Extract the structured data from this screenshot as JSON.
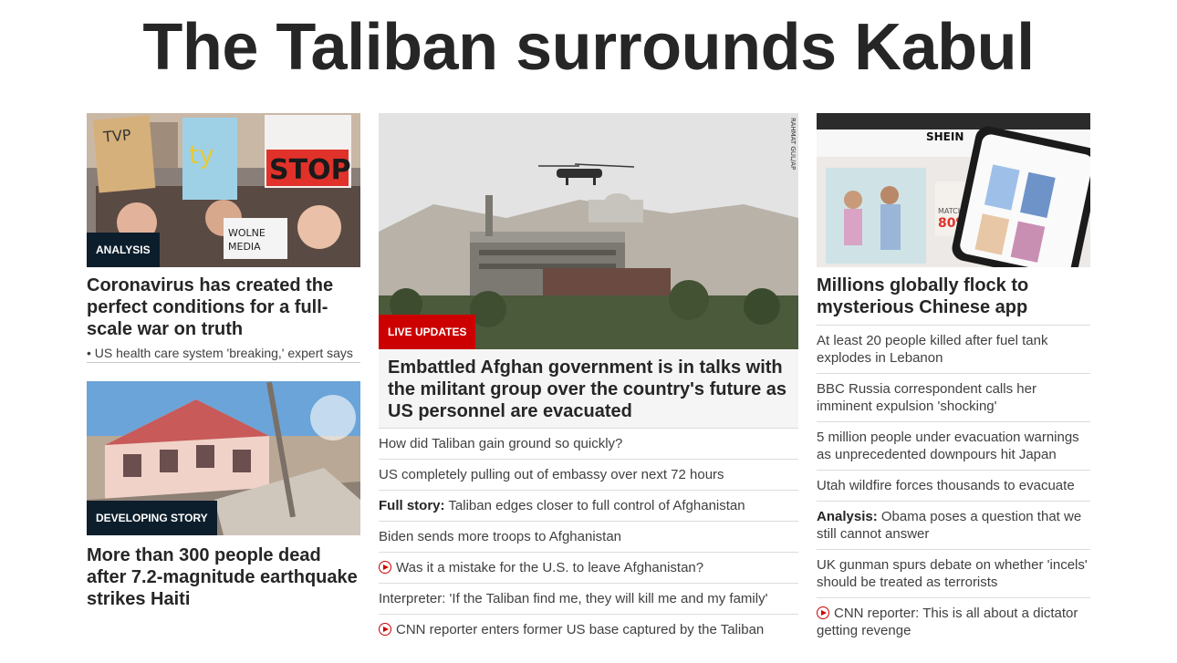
{
  "page": {
    "headline": "The Taliban surrounds Kabul"
  },
  "left": {
    "story1": {
      "badge": "ANALYSIS",
      "title": "Coronavirus has created the perfect conditions for a full-scale war on truth",
      "sublink": "• US health care system 'breaking,' expert says",
      "image_icon": "protest-photo"
    },
    "story2": {
      "badge": "DEVELOPING STORY",
      "title": "More than 300 people dead after 7.2-magnitude earthquake strikes Haiti",
      "image_icon": "earthquake-photo"
    }
  },
  "middle": {
    "badge": "LIVE UPDATES",
    "title": "Embattled Afghan government is in talks with the militant group over the country's future as US personnel are evacuated",
    "photo_credit": "RAHMAT GUL/AP",
    "image_icon": "helicopter-embassy-photo",
    "links": [
      {
        "prefix": "",
        "text": "How did Taliban gain ground so quickly?",
        "video": false
      },
      {
        "prefix": "",
        "text": "US completely pulling out of embassy over next 72 hours",
        "video": false
      },
      {
        "prefix": "Full story:",
        "text": " Taliban edges closer to full control of Afghanistan",
        "video": false
      },
      {
        "prefix": "",
        "text": "Biden sends more troops to Afghanistan",
        "video": false
      },
      {
        "prefix": "",
        "text": "Was it a mistake for the U.S. to leave Afghanistan?",
        "video": true
      },
      {
        "prefix": "",
        "text": "Interpreter: 'If the Taliban find me, they will kill me and my family'",
        "video": false
      },
      {
        "prefix": "",
        "text": "CNN reporter enters former US base captured by the Taliban",
        "video": true
      }
    ]
  },
  "right": {
    "title": "Millions globally flock to mysterious Chinese app",
    "image_icon": "shein-app-photo",
    "image_text": {
      "brand": "SHEIN",
      "promo": "MATCHING APP",
      "discount": "80% O"
    },
    "links": [
      {
        "prefix": "",
        "text": "At least 20 people killed after fuel tank explodes in Lebanon",
        "video": false
      },
      {
        "prefix": "",
        "text": "BBC Russia correspondent calls her imminent expulsion 'shocking'",
        "video": false
      },
      {
        "prefix": "",
        "text": "5 million people under evacuation warnings as unprecedented downpours hit Japan",
        "video": false
      },
      {
        "prefix": "",
        "text": "Utah wildfire forces thousands to evacuate",
        "video": false
      },
      {
        "prefix": "Analysis:",
        "text": " Obama poses a question that we still cannot answer",
        "video": false
      },
      {
        "prefix": "",
        "text": "UK gunman spurs debate on whether 'incels' should be treated as terrorists",
        "video": false
      },
      {
        "prefix": "",
        "text": "CNN reporter: This is all about a dictator getting revenge",
        "video": true
      }
    ]
  },
  "colors": {
    "badge_dark": "#0c1e2c",
    "badge_red": "#cc0000",
    "text": "#262626"
  }
}
